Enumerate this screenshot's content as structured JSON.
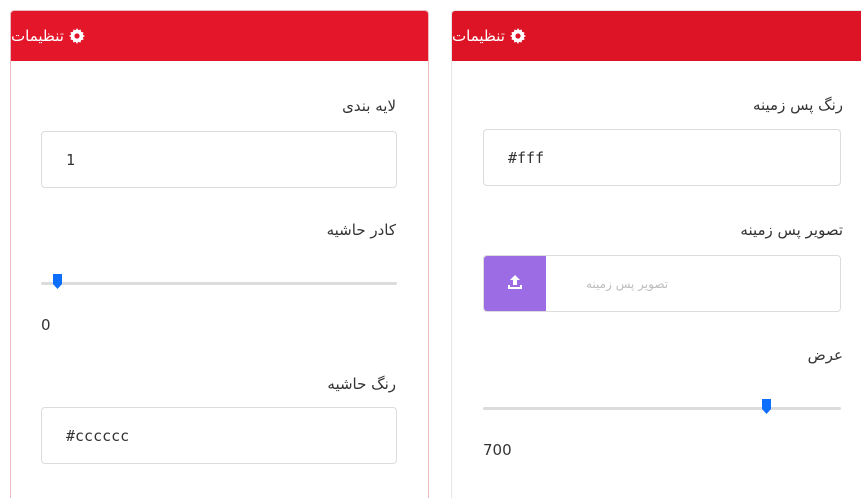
{
  "left_panel": {
    "header_title": "تنظیمات",
    "layer_label": "لایه بندی",
    "layer_value": "1",
    "border_label": "کادر حاشیه",
    "border_value": "0",
    "border_color_label": "رنگ حاشیه",
    "border_color_value": "#cccccc"
  },
  "right_panel": {
    "header_title": "تنظیمات",
    "bg_color_label": "رنگ پس زمینه",
    "bg_color_value": "#fff",
    "bg_image_label": "تصویر پس زمینه",
    "bg_image_placeholder": "تصویر پس زمینه",
    "width_label": "عرض",
    "width_value": "700"
  },
  "sliders": {
    "border_fraction": 0.0,
    "width_fraction": 0.82
  },
  "colors": {
    "header_red": "#e3162a",
    "upload_purple": "#9b6ce3",
    "thumb_blue": "#0d6efd"
  },
  "icons": [
    "gear-icon",
    "upload-icon"
  ]
}
